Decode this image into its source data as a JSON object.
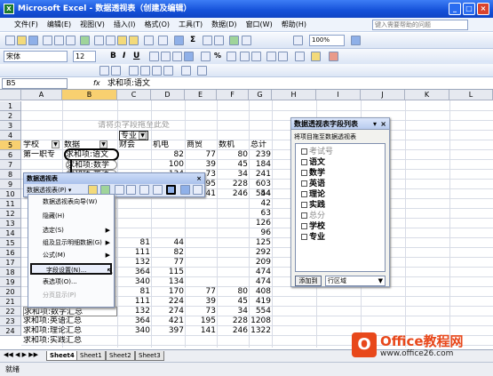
{
  "window": {
    "title": "Microsoft Excel - 数据透视表（创建及编辑）"
  },
  "menu": [
    "文件(F)",
    "编辑(E)",
    "视图(V)",
    "插入(I)",
    "格式(O)",
    "工具(T)",
    "数据(D)",
    "窗口(W)",
    "帮助(H)"
  ],
  "help_placeholder": "键入需要帮助的问题",
  "font": {
    "name": "宋体",
    "size": "12"
  },
  "zoom": "100%",
  "namebox": "B5",
  "formula": "求和项:语文",
  "columns": [
    "A",
    "B",
    "C",
    "D",
    "E",
    "F",
    "G",
    "H",
    "I",
    "J",
    "K",
    "L"
  ],
  "rows": [
    "1",
    "2",
    "3",
    "4",
    "5",
    "6",
    "7",
    "8",
    "9",
    "10",
    "11",
    "12",
    "13",
    "14",
    "15",
    "16",
    "17",
    "18",
    "19",
    "20",
    "21",
    "22",
    "23",
    "24"
  ],
  "cells": {
    "r2": "请将页字段拖至此处",
    "r3c": "专业",
    "r4": [
      "学校",
      "数据",
      "财会",
      "机电",
      "商贸",
      "数机",
      "总计"
    ],
    "r5": [
      "第一职专",
      "求和项:语文",
      "82",
      "77",
      "80",
      "239"
    ],
    "r6": [
      "求和项:数学",
      "100",
      "39",
      "45",
      "184"
    ],
    "r7": [
      "求和项:英语",
      "134",
      "73",
      "34",
      "241"
    ],
    "r8": [
      "195",
      "228",
      "603"
    ],
    "r9": [
      "241",
      "246",
      "554"
    ],
    "g_col": [
      "44",
      "42",
      "63",
      "126",
      "96",
      "125",
      "292",
      "209",
      "474",
      "474",
      "408",
      "419",
      "554",
      "1208",
      "1322"
    ],
    "c_col": [
      "81",
      "111",
      "132",
      "364",
      "340",
      "81",
      "111",
      "132",
      "364",
      "340"
    ],
    "d_col": [
      "44",
      "82",
      "77",
      "115",
      "134",
      "170",
      "224",
      "274",
      "421",
      "397"
    ],
    "e_col": [
      "77",
      "39",
      "73",
      "195",
      "141"
    ],
    "f_col": [
      "80",
      "45",
      "34",
      "228",
      "246"
    ],
    "a_rows": [
      "求和项:数学汇总",
      "求和项:英语汇总",
      "求和项:理论汇总",
      "求和项:实践汇总"
    ]
  },
  "field_panel": {
    "title": "数据透视表字段列表",
    "hint": "将项目拖至数据透视表",
    "fields": [
      "考试号",
      "语文",
      "数学",
      "英语",
      "理论",
      "实践",
      "总分",
      "学校",
      "专业"
    ],
    "add_button": "添加到",
    "area": "行区域"
  },
  "pivot_toolbar": {
    "title": "数据透视表",
    "menu_label": "数据透视表(P)"
  },
  "pivot_menu": {
    "items": [
      "数据透视表向导(W)",
      "隐藏(H)",
      "选定(S)",
      "组及显示明细数据(G)",
      "公式(M)",
      "字段设置(N)...",
      "表选项(O)...",
      "分页显示(P)"
    ]
  },
  "sheets": [
    "Sheet4",
    "Sheet1",
    "Sheet2",
    "Sheet3"
  ],
  "status": "就绪",
  "watermark": {
    "brand": "Office教程网",
    "url": "www.office26.com"
  }
}
